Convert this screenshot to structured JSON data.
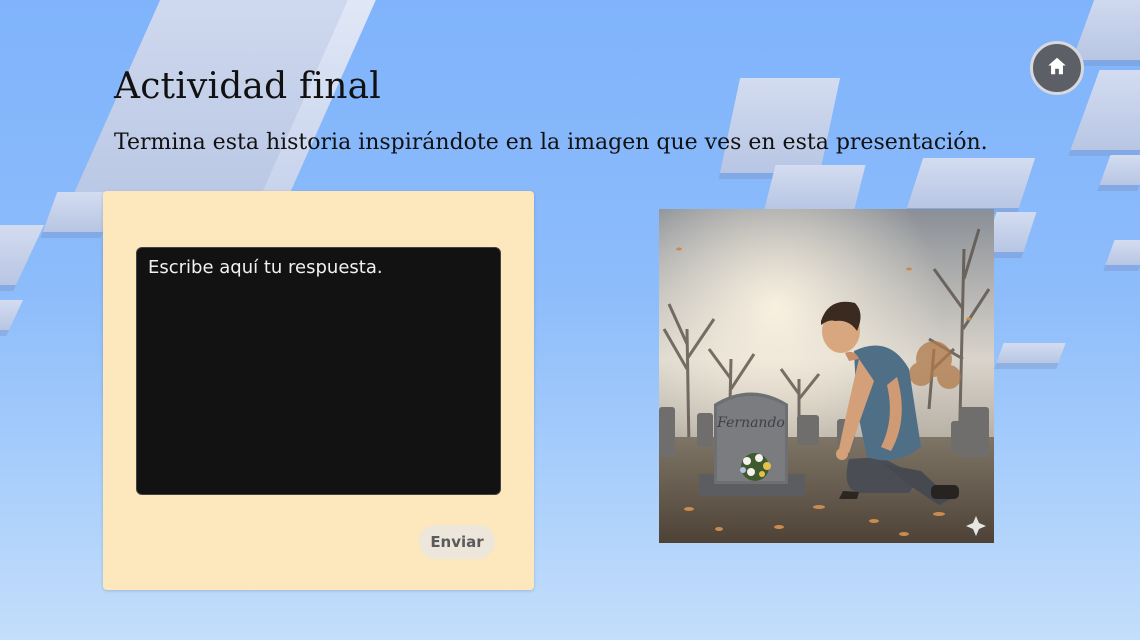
{
  "page": {
    "title": "Actividad final",
    "subtitle": "Termina esta historia inspirándote en la imagen que ves en esta presentación."
  },
  "nav": {
    "home_icon": "home-icon"
  },
  "answer": {
    "placeholder": "Escribe aquí tu respuesta.",
    "value": ""
  },
  "actions": {
    "send_label": "Enviar"
  },
  "illustration": {
    "tombstone_name": "Fernando"
  },
  "colors": {
    "background": "#8dbcfb",
    "card": "#fce8bc",
    "textarea": "#121212",
    "send_button": "#ede6db",
    "home_button": "#5d5f66"
  }
}
